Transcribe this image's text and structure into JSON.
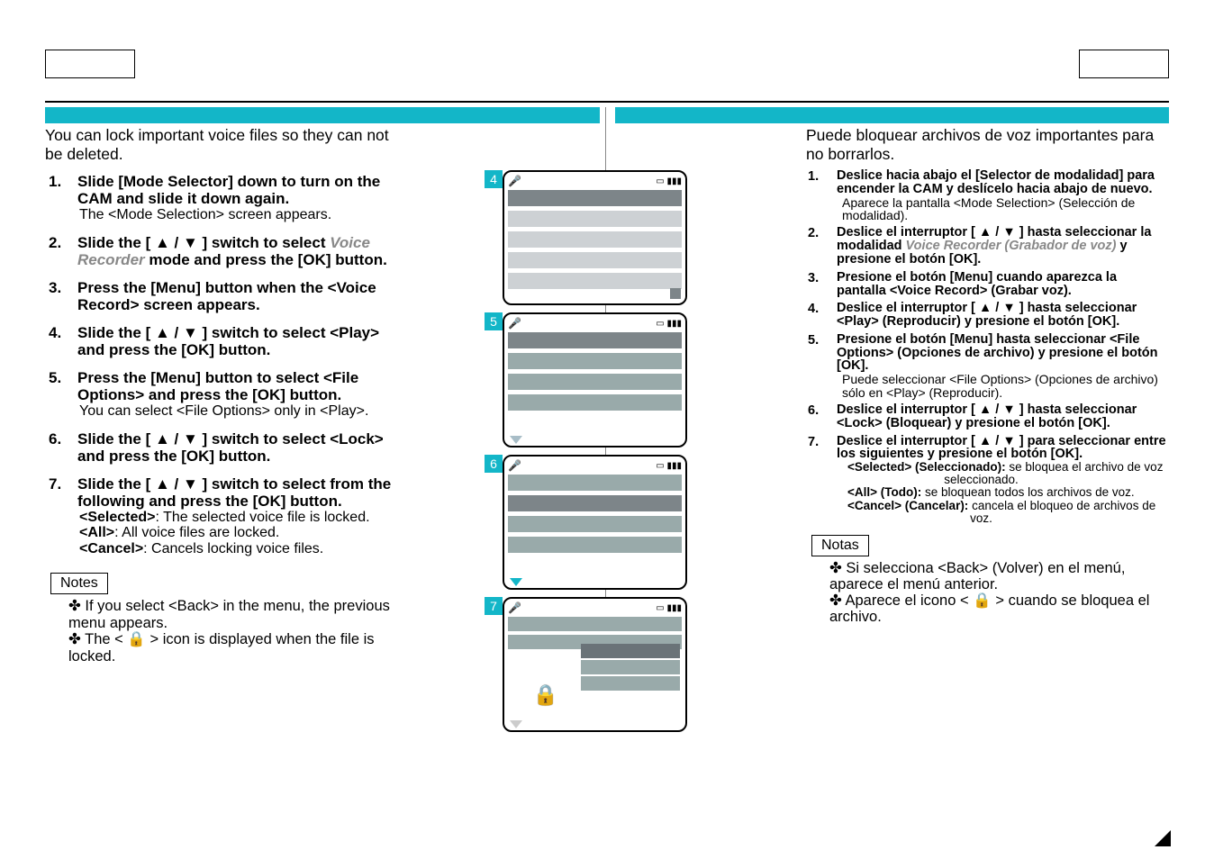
{
  "left": {
    "intro": "You can lock important voice files so they can not be deleted.",
    "steps": [
      {
        "n": "1.",
        "t": "Slide [Mode Selector] down to turn on the CAM and slide it down again.",
        "s": "The <Mode Selection> screen appears."
      },
      {
        "n": "2.",
        "t_pre": "Slide the [ ▲ / ▼ ] switch to select ",
        "t_it": "Voice Recorder",
        "t_post": " mode and press the [OK] button."
      },
      {
        "n": "3.",
        "t": "Press the [Menu] button when the <Voice Record> screen appears."
      },
      {
        "n": "4.",
        "t": "Slide the [ ▲ / ▼ ] switch to select <Play> and press the [OK] button."
      },
      {
        "n": "5.",
        "t": "Press the [Menu] button to select <File Options> and press the [OK] button.",
        "s": "You can select <File Options> only in <Play>."
      },
      {
        "n": "6.",
        "t": "Slide the [ ▲ / ▼ ] switch to select <Lock> and press the [OK] button."
      },
      {
        "n": "7.",
        "t": "Slide the [ ▲ / ▼ ] switch to select from the following and press the [OK] button.",
        "subs": [
          {
            "b": "<Selected>",
            "r": ": The selected voice file is locked."
          },
          {
            "b": "<All>",
            "r": ": All voice files are locked."
          },
          {
            "b": "<Cancel>",
            "r": ": Cancels locking voice files."
          }
        ]
      }
    ],
    "notes_label": "Notes",
    "notes": [
      "If you select <Back> in the menu, the previous menu appears.",
      "The < 🔒 > icon is displayed when the file is locked."
    ]
  },
  "right": {
    "intro": "Puede bloquear archivos de voz importantes para no borrarlos.",
    "steps": [
      {
        "n": "1.",
        "t": "Deslice hacia abajo el [Selector de modalidad] para encender la CAM y deslícelo hacia abajo de nuevo.",
        "s": "Aparece la pantalla <Mode Selection> (Selección de modalidad)."
      },
      {
        "n": "2.",
        "t_pre": "Deslice el interruptor [ ▲ / ▼ ] hasta seleccionar la modalidad ",
        "t_it": "Voice Recorder (Grabador de voz)",
        "t_post": " y presione el botón [OK]."
      },
      {
        "n": "3.",
        "t": "Presione el botón [Menu] cuando aparezca la pantalla <Voice Record> (Grabar voz)."
      },
      {
        "n": "4.",
        "t": "Deslice el interruptor [ ▲ / ▼ ] hasta seleccionar <Play> (Reproducir) y presione el botón [OK]."
      },
      {
        "n": "5.",
        "t": "Presione el botón [Menu] hasta seleccionar <File Options> (Opciones de archivo) y presione el botón [OK].",
        "s": "Puede seleccionar <File Options> (Opciones de archivo) sólo en <Play> (Reproducir)."
      },
      {
        "n": "6.",
        "t": "Deslice el interruptor [ ▲ / ▼ ] hasta seleccionar <Lock> (Bloquear) y presione el botón [OK]."
      },
      {
        "n": "7.",
        "t": "Deslice el interruptor [ ▲ / ▼ ] para seleccionar entre los siguientes y presione el botón [OK].",
        "subs": [
          {
            "b": "<Selected> (Seleccionado):",
            "r": " se bloquea el archivo de voz",
            "r2": "seleccionado."
          },
          {
            "b": "<All> (Todo):",
            "r": " se bloquean todos los archivos de voz."
          },
          {
            "b": "<Cancel> (Cancelar):",
            "r": " cancela el bloqueo de archivos de",
            "r2": "voz."
          }
        ]
      }
    ],
    "notes_label": "Notas",
    "notes": [
      "Si selecciona <Back> (Volver) en el menú, aparece el menú anterior.",
      "Aparece el icono < 🔒 > cuando se bloquea el archivo."
    ]
  },
  "figs": [
    "4",
    "5",
    "6",
    "7"
  ]
}
